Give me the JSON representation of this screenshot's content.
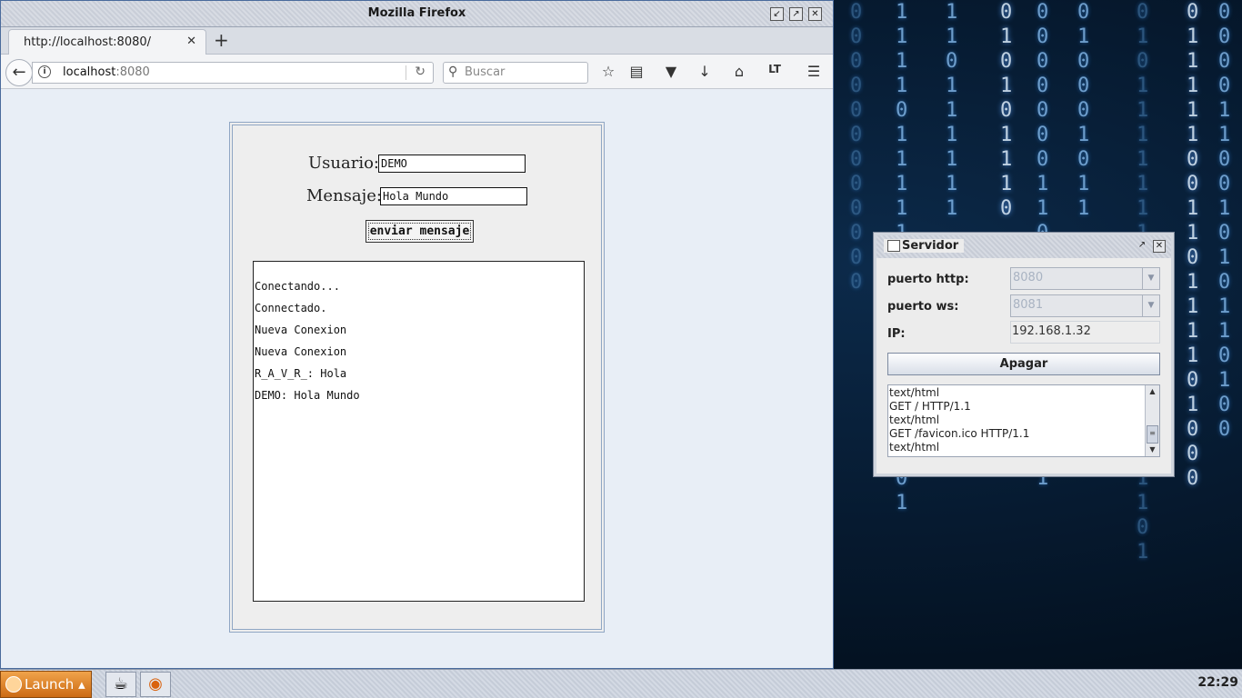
{
  "firefox": {
    "window_title": "Mozilla Firefox",
    "tab_title": "http://localhost:8080/",
    "url_host": "localhost",
    "url_port": ":8080",
    "search_placeholder": "Buscar"
  },
  "chat_page": {
    "user_label": "Usuario:",
    "user_value": "DEMO",
    "message_label": "Mensaje:",
    "message_value": "Hola Mundo",
    "send_label": "enviar mensaje",
    "log": [
      "Conectando...",
      "Connectado.",
      "Nueva Conexion",
      "Nueva Conexion",
      "R_A_V_R_: Hola",
      "DEMO: Hola Mundo"
    ]
  },
  "server_window": {
    "title": "Servidor",
    "http_port_label": "puerto http:",
    "http_port_value": "8080",
    "ws_port_label": "puerto ws:",
    "ws_port_value": "8081",
    "ip_label": "IP:",
    "ip_value": "192.168.1.32",
    "button_label": "Apagar",
    "log": [
      "text/html",
      "GET / HTTP/1.1",
      "text/html",
      "GET /favicon.ico HTTP/1.1",
      "text/html"
    ]
  },
  "taskbar": {
    "launch_label": "Launch",
    "clock": "22:29"
  },
  "colors": {
    "launch_orange": "#cc6b14",
    "matrix_blue": "#7fb4e6"
  }
}
